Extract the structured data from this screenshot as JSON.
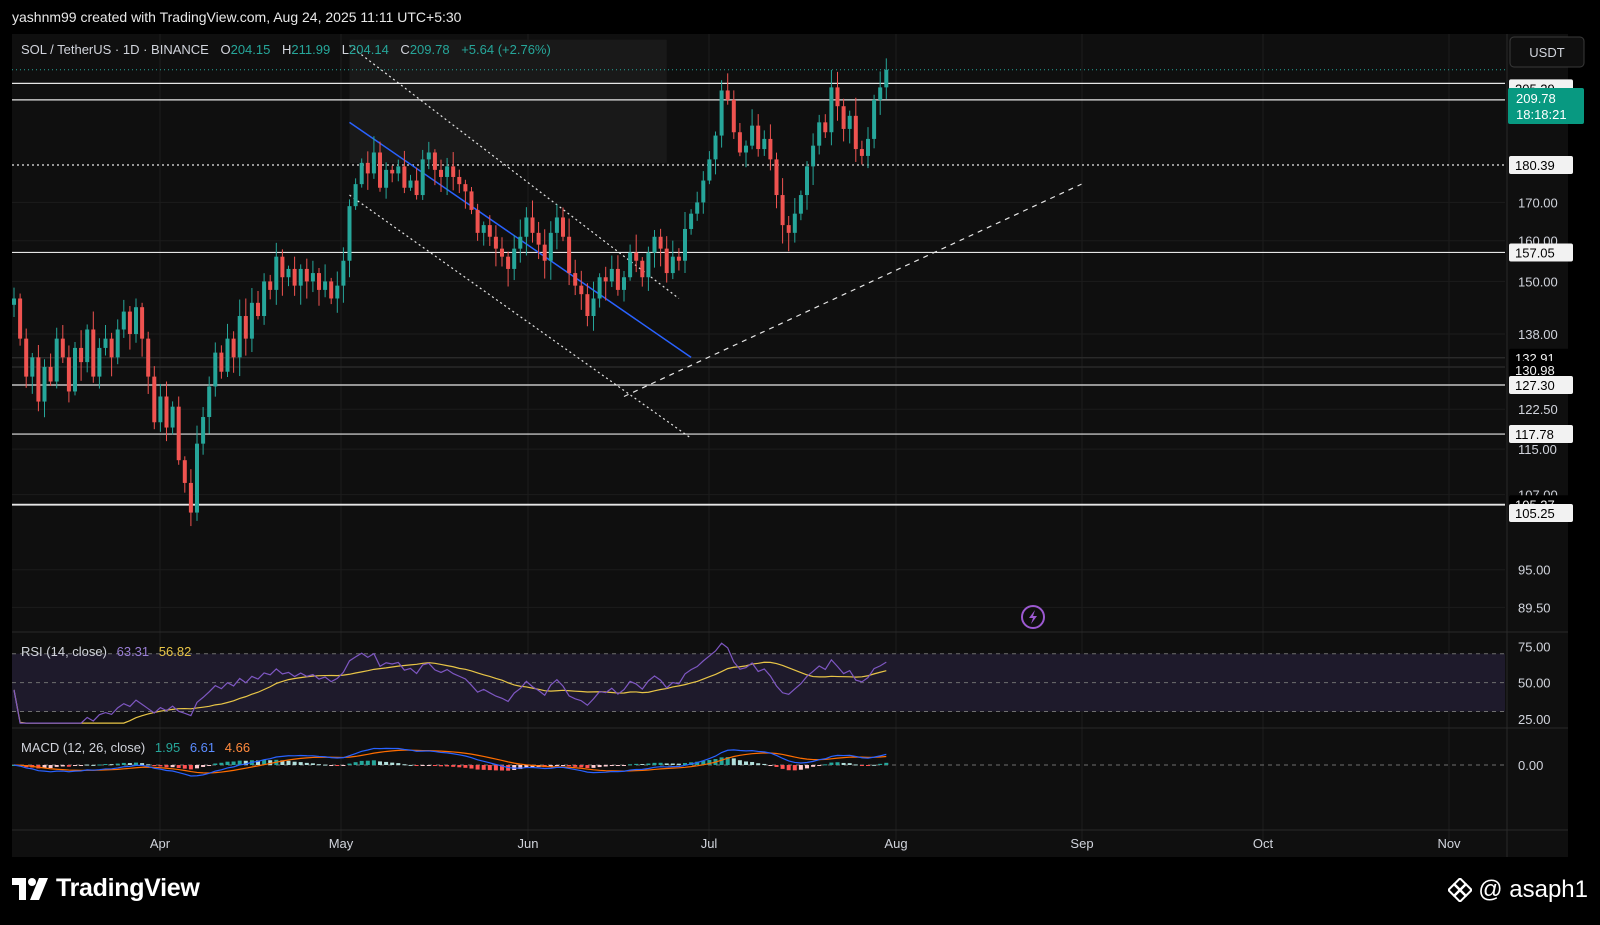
{
  "header": {
    "credit": "yashnm99 created with TradingView.com, Aug 24, 2025 11:11 UTC+5:30"
  },
  "legend": {
    "symbol": "SOL / TetherUS · 1D · BINANCE",
    "open_label": "O",
    "open": "204.15",
    "high_label": "H",
    "high": "211.99",
    "low_label": "L",
    "low": "204.14",
    "close_label": "C",
    "close": "209.78",
    "change": "+5.64 (+2.76%)"
  },
  "currency_button": "USDT",
  "price_tag": {
    "price": "209.78",
    "countdown": "18:18:21"
  },
  "colors": {
    "up": "#26a69a",
    "down": "#ef5350",
    "rsi": "#7e57c2",
    "rsi_ma": "#e8c547",
    "macd": "#2962ff",
    "signal": "#ff6d00",
    "channel": "#2962ff",
    "tag_bg": "#089981"
  },
  "chart_data": {
    "type": "candlestick",
    "symbol": "SOL/USDT",
    "timeframe": "1D",
    "x_ticks": [
      "Apr",
      "May",
      "Jun",
      "Jul",
      "Aug",
      "Sep",
      "Oct",
      "Nov"
    ],
    "y_ticks": [
      "170.00",
      "160.00",
      "150.00",
      "138.00",
      "122.50",
      "115.00",
      "107.00",
      "95.00",
      "89.50"
    ],
    "log_scale": true,
    "ylim": [
      88,
      222
    ],
    "closes": [
      146,
      137,
      129,
      133,
      124,
      131,
      128,
      137,
      133,
      126,
      135,
      132,
      139,
      129,
      135,
      137,
      133,
      139,
      143,
      138,
      144,
      137,
      129,
      120,
      125,
      119,
      123,
      113,
      109,
      104,
      116,
      121,
      127,
      134,
      130,
      137,
      133,
      142,
      137,
      145,
      142,
      150,
      148,
      156,
      151,
      153,
      149,
      153,
      150,
      152,
      148,
      150,
      146,
      149,
      155,
      169,
      175,
      181,
      178,
      184,
      174,
      179,
      178,
      180,
      174,
      176,
      172,
      182,
      184,
      179,
      177,
      180,
      177,
      175,
      173,
      168,
      162,
      164,
      161,
      158,
      156,
      153,
      158,
      161,
      166,
      162,
      159,
      155,
      162,
      166,
      161,
      152,
      149,
      147,
      142,
      146,
      151,
      150,
      153,
      148,
      151,
      157,
      155,
      151,
      157,
      161,
      158,
      152,
      156,
      155,
      163,
      167,
      170,
      176,
      182,
      189,
      203,
      200,
      190,
      184,
      186,
      192,
      185,
      188,
      182,
      172,
      164,
      162,
      167,
      172,
      180,
      186,
      193,
      190,
      204,
      198,
      191,
      195,
      185,
      183,
      188,
      200,
      204,
      209.78
    ],
    "levels": [
      205.29,
      199.99,
      180.39,
      157.05,
      132.91,
      130.98,
      127.3,
      117.78,
      105.37,
      105.25
    ],
    "level_labels": [
      "205.29",
      "199.99",
      "180.39",
      "157.05",
      "132.91",
      "130.98",
      "127.30",
      "117.78",
      "105.37",
      "105.25"
    ],
    "rsi": {
      "label": "RSI (14, close)",
      "value": "63.31",
      "ma_value": "56.82",
      "ticks": [
        "75.00",
        "50.00",
        "25.00"
      ],
      "upper": 70,
      "middle": 50,
      "lower": 30
    },
    "macd": {
      "label": "MACD (12, 26, close)",
      "hist": "1.95",
      "macd": "6.61",
      "signal": "4.66",
      "ticks": [
        "0.00"
      ]
    }
  },
  "icons": {
    "tv_logo": "tradingview-logo-icon",
    "author": "binance-diamond-icon",
    "lightning": "lightning-icon"
  },
  "footer": {
    "brand": "TradingView",
    "author": "@ asaph1"
  }
}
